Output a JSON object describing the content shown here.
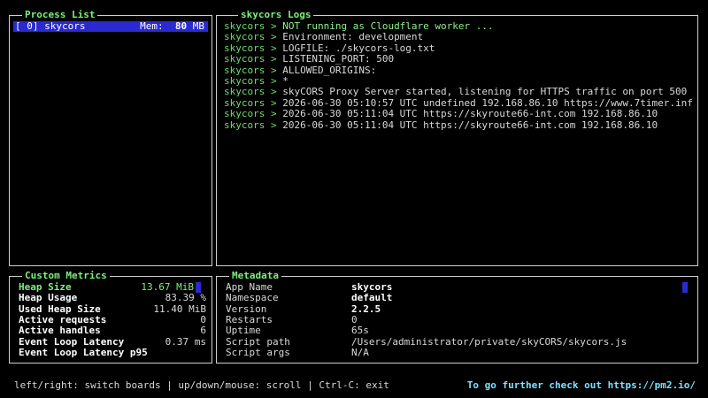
{
  "process_list": {
    "title": "Process List",
    "selected_row": {
      "label": "[ 0] skycors",
      "mem_label": "Mem:",
      "mem_value": "80",
      "mem_unit": "MB"
    }
  },
  "logs": {
    "title": "skycors Logs",
    "prefix": "skycors >",
    "lines": [
      "NOT running as Cloudflare worker ...",
      "Environment: development",
      "LOGFILE: ./skycors-log.txt",
      "LISTENING_PORT: 500",
      "ALLOWED_ORIGINS:",
      "*",
      "skyCORS Proxy Server started, listening for HTTPS traffic on port 500",
      "2026-06-30 05:10:57 UTC undefined 192.168.86.10 https://www.7timer.inf",
      "2026-06-30 05:11:04 UTC https://skyroute66-int.com 192.168.86.10",
      "2026-06-30 05:11:04 UTC https://skyroute66-int.com 192.168.86.10"
    ]
  },
  "metrics": {
    "title": "Custom Metrics",
    "rows": [
      {
        "label": "Heap Size",
        "value": "13.67 MiB"
      },
      {
        "label": "Heap Usage",
        "value": "83.39 %"
      },
      {
        "label": "Used Heap Size",
        "value": "11.40 MiB"
      },
      {
        "label": "Active requests",
        "value": "0"
      },
      {
        "label": "Active handles",
        "value": "6"
      },
      {
        "label": "Event Loop Latency",
        "value": "0.37 ms"
      },
      {
        "label": "Event Loop Latency p95",
        "value": ""
      }
    ]
  },
  "metadata": {
    "title": "Metadata",
    "rows": [
      {
        "key": "App Name",
        "value": "skycors"
      },
      {
        "key": "Namespace",
        "value": "default"
      },
      {
        "key": "Version",
        "value": "2.2.5"
      },
      {
        "key": "Restarts",
        "value": "0"
      },
      {
        "key": "Uptime",
        "value": "65s"
      },
      {
        "key": "Script path",
        "value": "/Users/administrator/private/skyCORS/skycors.js"
      },
      {
        "key": "Script args",
        "value": "N/A"
      }
    ]
  },
  "footer": {
    "help": "left/right: switch boards | up/down/mouse: scroll | Ctrl-C: exit",
    "promo": "To go further check out https://pm2.io/"
  },
  "colors": {
    "accent_green": "#7cf07c",
    "selection_blue": "#2a2ad0",
    "link_cyan": "#7fe0ff",
    "border": "#cfcfcf"
  }
}
